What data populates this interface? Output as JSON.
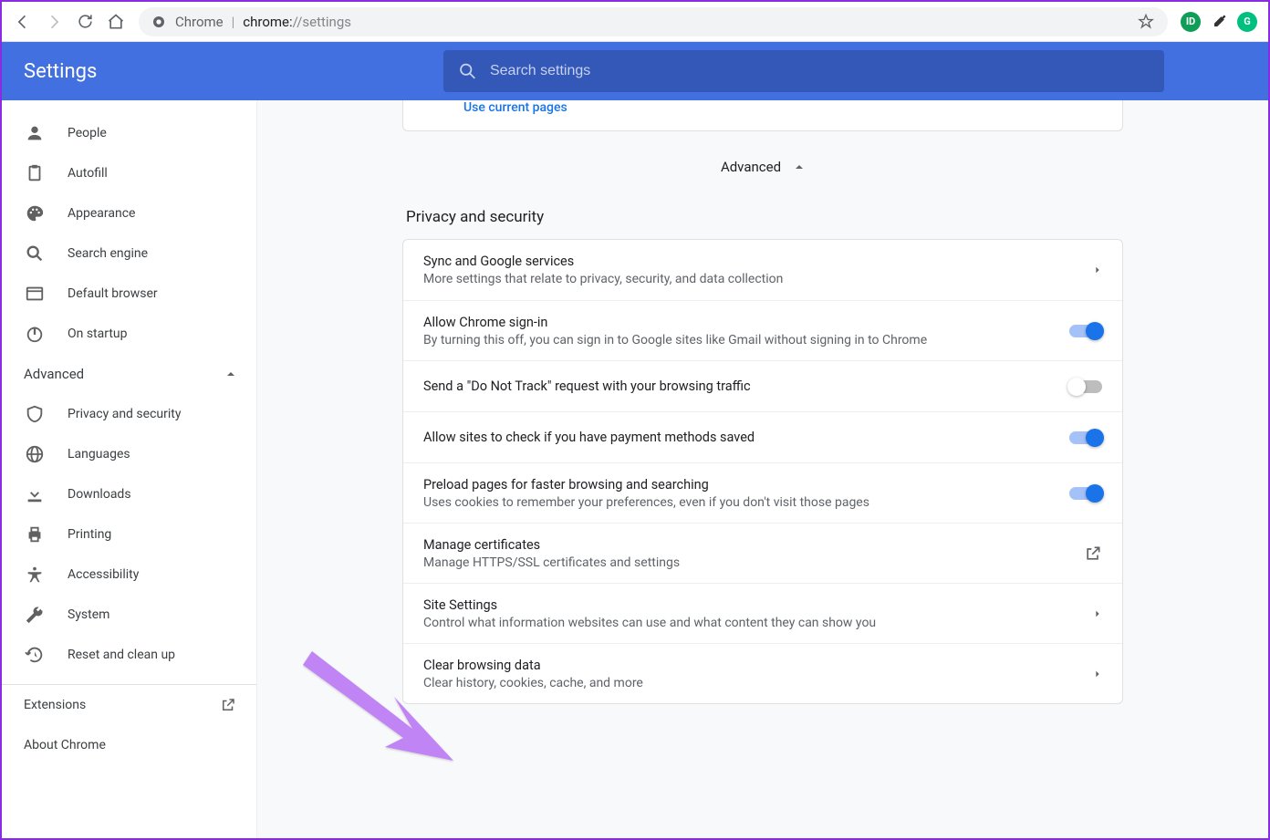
{
  "browser": {
    "omnibox_label": "Chrome",
    "url_strong": "chrome:",
    "url_rest": "//settings"
  },
  "header": {
    "title": "Settings",
    "search_placeholder": "Search settings"
  },
  "sidebar": {
    "items": [
      {
        "label": "People"
      },
      {
        "label": "Autofill"
      },
      {
        "label": "Appearance"
      },
      {
        "label": "Search engine"
      },
      {
        "label": "Default browser"
      },
      {
        "label": "On startup"
      }
    ],
    "advanced_label": "Advanced",
    "adv_items": [
      {
        "label": "Privacy and security"
      },
      {
        "label": "Languages"
      },
      {
        "label": "Downloads"
      },
      {
        "label": "Printing"
      },
      {
        "label": "Accessibility"
      },
      {
        "label": "System"
      },
      {
        "label": "Reset and clean up"
      }
    ],
    "extensions_label": "Extensions",
    "about_label": "About Chrome"
  },
  "main": {
    "use_current_pages": "Use current pages",
    "advanced_label": "Advanced",
    "section_title": "Privacy and security",
    "rows": [
      {
        "title": "Sync and Google services",
        "sub": "More settings that relate to privacy, security, and data collection",
        "action": "chevron"
      },
      {
        "title": "Allow Chrome sign-in",
        "sub": "By turning this off, you can sign in to Google sites like Gmail without signing in to Chrome",
        "action": "toggle",
        "on": true
      },
      {
        "title": "Send a \"Do Not Track\" request with your browsing traffic",
        "sub": "",
        "action": "toggle",
        "on": false
      },
      {
        "title": "Allow sites to check if you have payment methods saved",
        "sub": "",
        "action": "toggle",
        "on": true
      },
      {
        "title": "Preload pages for faster browsing and searching",
        "sub": "Uses cookies to remember your preferences, even if you don't visit those pages",
        "action": "toggle",
        "on": true
      },
      {
        "title": "Manage certificates",
        "sub": "Manage HTTPS/SSL certificates and settings",
        "action": "external"
      },
      {
        "title": "Site Settings",
        "sub": "Control what information websites can use and what content they can show you",
        "action": "chevron"
      },
      {
        "title": "Clear browsing data",
        "sub": "Clear history, cookies, cache, and more",
        "action": "chevron"
      }
    ]
  }
}
